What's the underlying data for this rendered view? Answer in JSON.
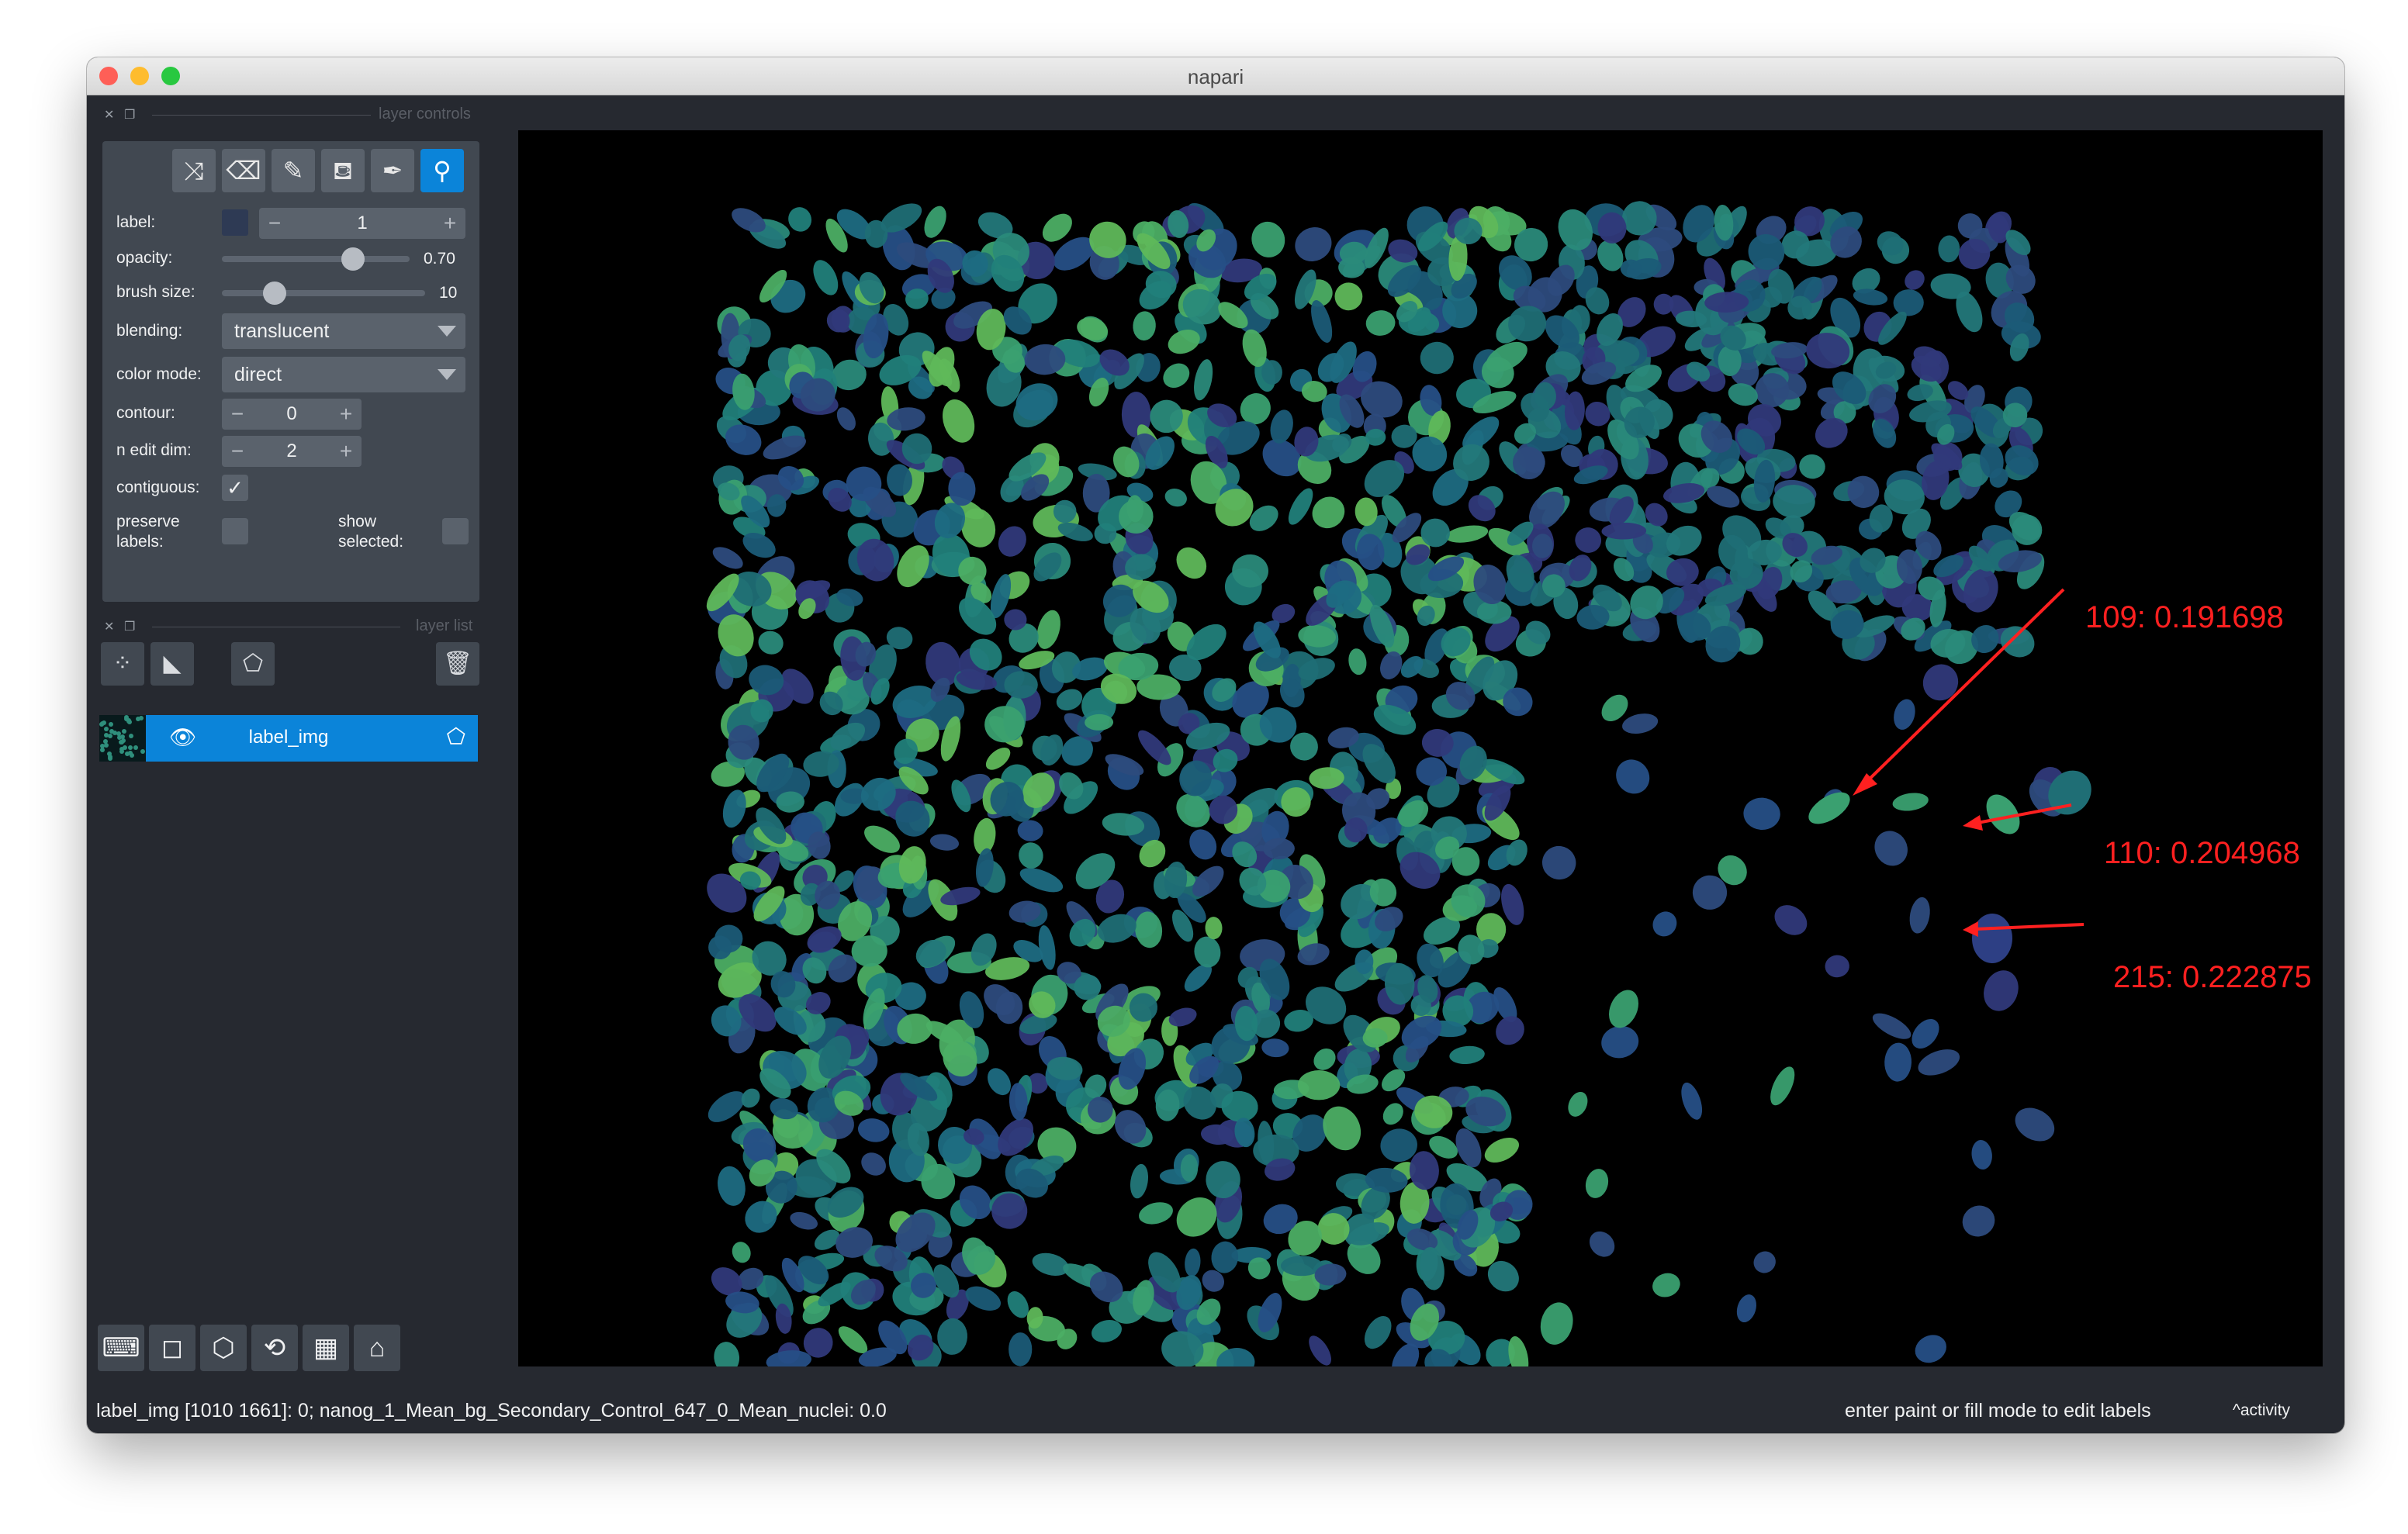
{
  "window": {
    "title": "napari"
  },
  "layer_controls": {
    "header": "layer controls",
    "tools": [
      {
        "name": "shuffle-icon",
        "glyph": "⤨"
      },
      {
        "name": "eraser-icon",
        "glyph": "⌫"
      },
      {
        "name": "brush-icon",
        "glyph": "✎"
      },
      {
        "name": "fill-icon",
        "glyph": "⛾"
      },
      {
        "name": "picker-icon",
        "glyph": "✒"
      },
      {
        "name": "zoom-icon",
        "glyph": "⚲"
      }
    ],
    "label": {
      "text": "label:",
      "value": "1",
      "minus": "−",
      "plus": "+"
    },
    "opacity": {
      "text": "opacity:",
      "value": "0.70",
      "level": 0.7
    },
    "brush_size": {
      "text": "brush size:",
      "value": "10",
      "level": 0.26
    },
    "blending": {
      "text": "blending:",
      "value": "translucent"
    },
    "color_mode": {
      "text": "color mode:",
      "value": "direct"
    },
    "contour": {
      "text": "contour:",
      "value": "0",
      "minus": "−",
      "plus": "+"
    },
    "n_edit_dim": {
      "text": "n edit dim:",
      "value": "2",
      "minus": "−",
      "plus": "+"
    },
    "contiguous": {
      "text": "contiguous:",
      "checked": true,
      "mark": "✓"
    },
    "preserve_labels": {
      "text1": "preserve",
      "text2": "labels:"
    },
    "show_selected": {
      "text1": "show",
      "text2": "selected:"
    }
  },
  "layer_list": {
    "header": "layer list",
    "new_points": "⁘",
    "new_shapes": "◣",
    "new_labels": "⬠",
    "delete": "🗑",
    "layers": [
      {
        "name": "label_img",
        "visible_icon": "👁",
        "type_icon": "⬠"
      }
    ]
  },
  "bottom_tools": [
    {
      "name": "console-icon",
      "glyph": "⌨"
    },
    {
      "name": "ndisplay-icon",
      "glyph": "◻"
    },
    {
      "name": "roll-dims-icon",
      "glyph": "⬡"
    },
    {
      "name": "transpose-icon",
      "glyph": "⟲"
    },
    {
      "name": "grid-icon",
      "glyph": "▦"
    },
    {
      "name": "home-icon",
      "glyph": "⌂"
    }
  ],
  "status": {
    "left": "label_img [1010 1661]: 0; nanog_1_Mean_bg_Secondary_Control_647_0_Mean_nuclei: 0.0",
    "middle": "enter paint or fill mode to edit labels",
    "activity": "^activity"
  },
  "annotations": [
    {
      "text": "109: 0.191698"
    },
    {
      "text": "110: 0.204968"
    },
    {
      "text": "215: 0.222875"
    }
  ],
  "colors": {
    "accent": "#0b84d9",
    "annotation": "#ff2020",
    "canvas": "#000000"
  }
}
